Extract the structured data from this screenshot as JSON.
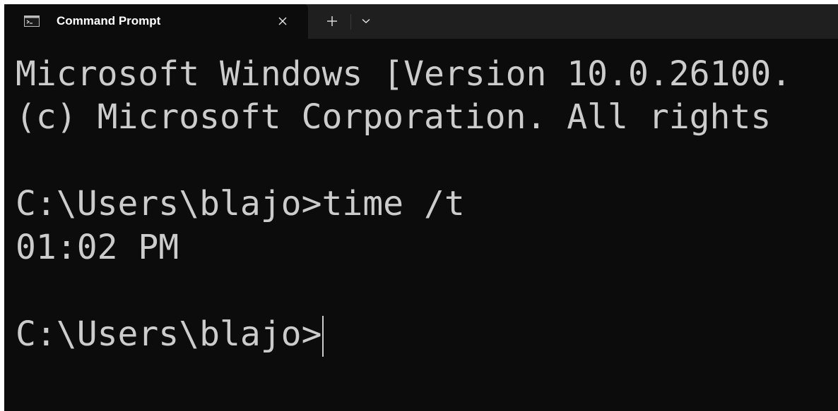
{
  "tab": {
    "title": "Command Prompt",
    "icon": "cmd-icon",
    "close_icon": "close-icon"
  },
  "toolbar": {
    "new_tab_icon": "plus-icon",
    "dropdown_icon": "chevron-down-icon"
  },
  "console": {
    "lines": [
      "Microsoft Windows [Version 10.0.26100.",
      "(c) Microsoft Corporation. All rights",
      "",
      "C:\\Users\\blajo>time /t",
      "01:02 PM",
      "",
      "C:\\Users\\blajo>"
    ]
  },
  "colors": {
    "background": "#0c0c0c",
    "tabbar": "#1f1f1f",
    "text": "#cccccc"
  }
}
